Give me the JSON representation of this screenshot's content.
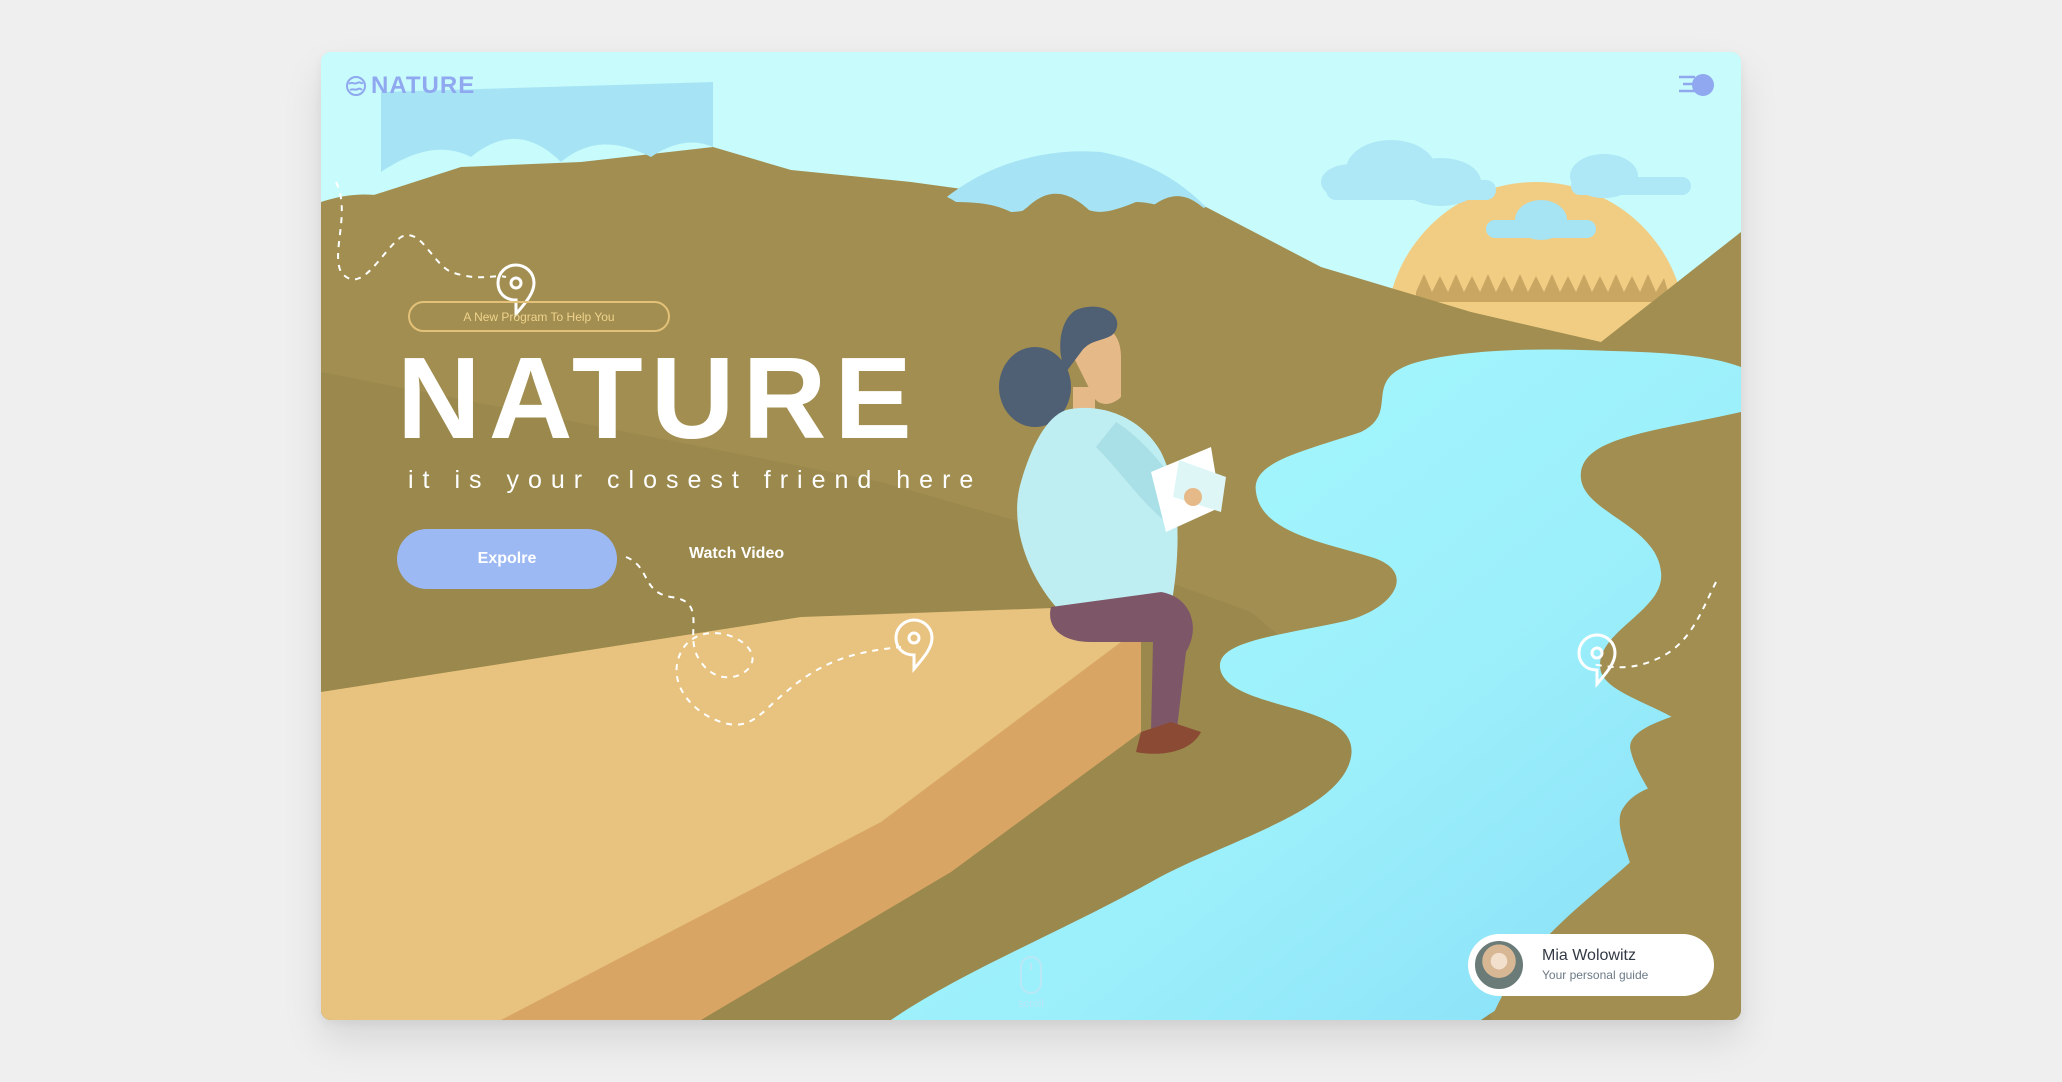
{
  "brand": {
    "name": "NATURE"
  },
  "hero": {
    "badge": "A New Program To Help You",
    "title": "NATURE",
    "subtitle": "it is your closest friend here",
    "explore_label": "Expolre",
    "watch_label": "Watch Video"
  },
  "scroll": {
    "label": "scroll"
  },
  "guide": {
    "name": "Mia Wolowitz",
    "role": "Your personal guide"
  },
  "colors": {
    "sky": "#c8fbfb",
    "mountain": "#a18e50",
    "cliff": "#e8c37f",
    "river": "#9ff2fb",
    "sun": "#f1cd84",
    "accent": "#9cb9f4"
  }
}
